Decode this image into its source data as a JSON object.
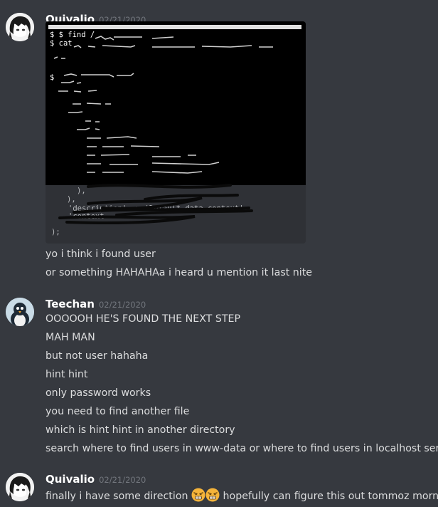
{
  "messages": [
    {
      "author": "Quivalio",
      "timestamp": "02/21/2020",
      "attachment": {
        "visible_text": [
          "$ $ find /",
          "$ cat",
          "$",
          "),",
          "),",
          "'description' => 'Default data context',",
          "'context",
          ");"
        ]
      },
      "lines": [
        "yo i think i found user",
        "or something HAHAHAa i heard u mention it last nite"
      ]
    },
    {
      "author": "Teechan",
      "timestamp": "02/21/2020",
      "lines": [
        "OOOOOH HE'S FOUND THE NEXT STEP",
        "MAH MAN",
        "but not user hahaha",
        "hint hint",
        "only password works",
        "you need to find another file",
        "which is hint hint in another directory",
        "search where to find users in www-data or where to find users in localhost server"
      ]
    },
    {
      "author": "Quivalio",
      "timestamp": "02/21/2020",
      "line_before_emoji": "finally i have some direction",
      "emoji_icons": [
        "tired-face-emoji-icon",
        "tired-face-emoji-icon"
      ],
      "line_after_emoji": "hopefully can figure this out tommoz morning"
    }
  ],
  "colors": {
    "background": "#36393f",
    "username": "#ffffff",
    "timestamp": "#72767d",
    "message_text": "#dcddde",
    "attachment_bg": "#2f3136"
  }
}
